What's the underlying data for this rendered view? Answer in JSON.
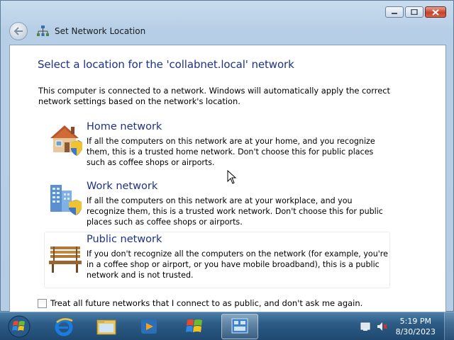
{
  "window": {
    "title": "Set Network Location",
    "caption_buttons": [
      "minimize",
      "maximize",
      "close"
    ]
  },
  "content": {
    "heading": "Select a location for the 'collabnet.local' network",
    "intro": "This computer is connected to a network. Windows will automatically apply the correct network settings based on the network's location.",
    "options": [
      {
        "title": "Home network",
        "description": "If all the computers on this network are at your home, and you recognize them, this is a trusted home network.  Don't choose this for public places such as coffee shops or airports.",
        "icon": "home-network-icon"
      },
      {
        "title": "Work network",
        "description": "If all the computers on this network are at your workplace, and you recognize them, this is a trusted work network.  Don't choose this for public places such as coffee shops or airports.",
        "icon": "work-network-icon"
      },
      {
        "title": "Public network",
        "description": "If you don't recognize all the computers on the network (for example, you're in a coffee shop or airport, or you have mobile broadband), this is a public network and is not trusted.",
        "icon": "public-network-icon"
      }
    ],
    "checkbox_label": "Treat all future networks that I connect to as public, and don't ask me again.",
    "checkbox_checked": false
  },
  "taskbar": {
    "items": [
      "start-orb",
      "internet-explorer-icon",
      "windows-explorer-icon",
      "media-player-icon",
      "windows-logo-app-icon",
      "network-app-icon"
    ],
    "time": "5:19 PM",
    "date": "8/30/2023"
  },
  "colors": {
    "heading": "#1e3287",
    "taskbar": "#2d5c86"
  }
}
